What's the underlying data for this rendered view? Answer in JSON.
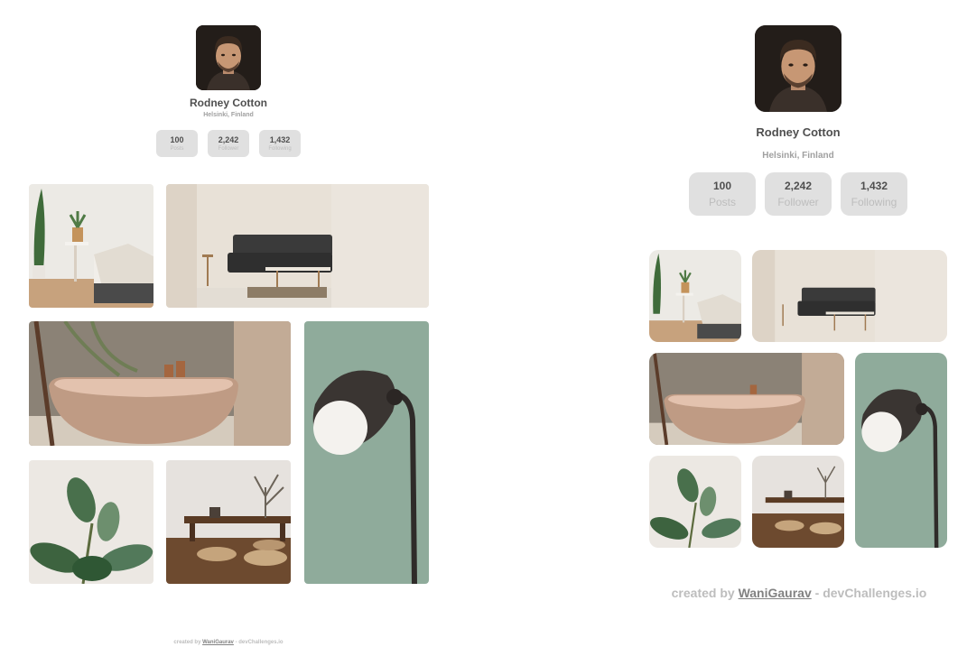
{
  "profile": {
    "name": "Rodney Cotton",
    "location": "Helsinki, Finland",
    "stats": [
      {
        "value": "100",
        "label": "Posts"
      },
      {
        "value": "2,242",
        "label": "Follower"
      },
      {
        "value": "1,432",
        "label": "Following"
      }
    ]
  },
  "gallery": [
    {
      "name": "bedroom-photo"
    },
    {
      "name": "living-room-photo"
    },
    {
      "name": "bathtub-photo"
    },
    {
      "name": "floor-lamp-photo"
    },
    {
      "name": "plant-photo"
    },
    {
      "name": "low-table-photo"
    }
  ],
  "footer": {
    "prefix": "created by",
    "author": "WaniGaurav",
    "suffix": "- devChallenges.io"
  },
  "colors": {
    "stat_bg": "#e0e0e0",
    "name_text": "#4f4f4f",
    "muted_text": "#bdbdbd",
    "lamp_wall": "#8fab9b"
  }
}
